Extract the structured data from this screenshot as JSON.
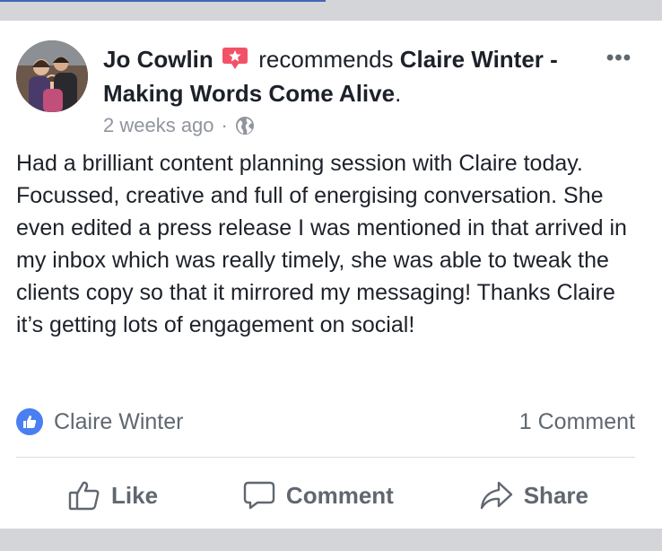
{
  "post": {
    "author": "Jo Cowlin",
    "verb": "recommends",
    "page_name": "Claire Winter - Making Words Come Alive",
    "page_suffix": ".",
    "timestamp": "2 weeks ago",
    "separator": "·",
    "privacy_icon": "globe-icon",
    "recommend_icon": "recommendation-star-icon",
    "more_label": "•••",
    "body": "Had a brilliant content planning session with Claire today. Focussed, creative and full of energising conversation. She even edited a press release I was mentioned in that arrived in my inbox which was really timely, she was able to tweak the clients copy so that it mirrored my messaging! Thanks Claire it’s getting lots of engagement on social!"
  },
  "reactions": {
    "liked_by": "Claire Winter",
    "comment_count": "1 Comment"
  },
  "actions": {
    "like_label": "Like",
    "comment_label": "Comment",
    "share_label": "Share"
  },
  "colors": {
    "accent": "#4267b2",
    "like_blue": "#4a7ff2",
    "recommend_red": "#f25268",
    "text": "#1d2129",
    "muted": "#90949c"
  }
}
